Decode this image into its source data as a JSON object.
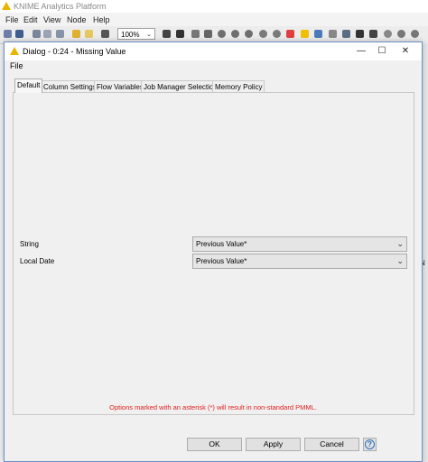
{
  "app": {
    "title": "KNIME Analytics Platform",
    "menu": [
      "File",
      "Edit",
      "View",
      "Node",
      "Help"
    ],
    "zoom": "100%",
    "right_strip_glyphs": [
      "|",
      "N"
    ]
  },
  "dialog": {
    "title": "Dialog - 0:24 - Missing Value",
    "menu_file": "File",
    "controls": {
      "minimize": "—",
      "maximize": "☐",
      "close": "✕"
    },
    "tabs": [
      "Default",
      "Column Settings",
      "Flow Variables",
      "Job Manager Selection",
      "Memory Policy"
    ],
    "active_tab": "Default",
    "rows": [
      {
        "label": "String",
        "value": "Previous Value*"
      },
      {
        "label": "Local Date",
        "value": "Previous Value*"
      }
    ],
    "notice": "Options marked with an asterisk (*) will result in non-standard PMML.",
    "buttons": {
      "ok": "OK",
      "apply": "Apply",
      "cancel": "Cancel",
      "help": "?"
    }
  },
  "colors": {
    "warning": "#e8b400",
    "notice_text": "#e02020",
    "dialog_border": "#6a8fc9",
    "help_blue": "#2a6ebd"
  }
}
